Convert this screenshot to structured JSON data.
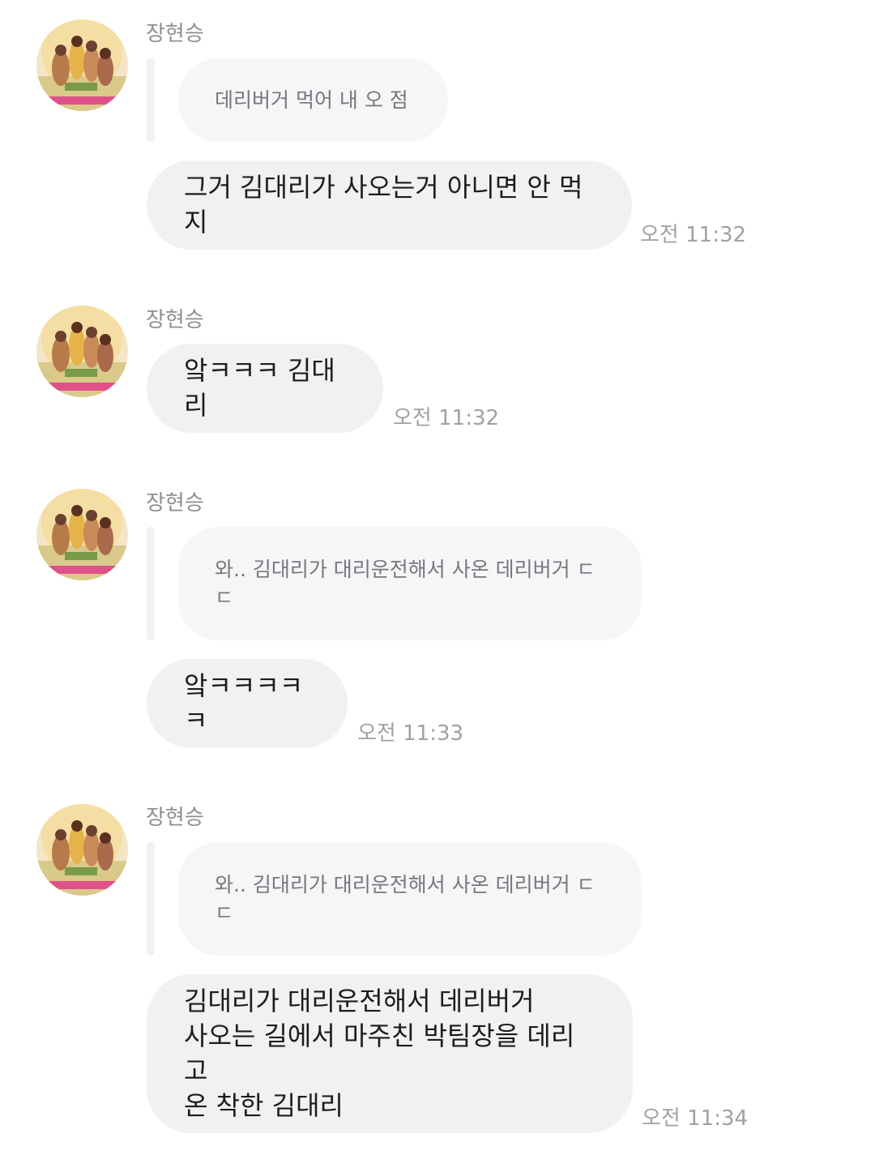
{
  "app": {
    "background": "#ffffff",
    "bubble_color": "#f1f1f4",
    "quote_color": "#f6f6f8"
  },
  "messages": [
    {
      "sender": "장현승",
      "quote": "데리버거 먹어 내 오 점",
      "text": "그거 김대리가 사오는거 아니면 안 먹지",
      "time": "오전 11:32"
    },
    {
      "sender": "장현승",
      "text": "앜ㅋㅋㅋ 김대리",
      "time": "오전 11:32"
    },
    {
      "sender": "장현승",
      "quote": "와.. 김대리가 대리운전해서 사온 데리버거 ㄷ\nㄷ",
      "text": "앜ㅋㅋㅋㅋㅋ",
      "time": "오전 11:33"
    },
    {
      "sender": "장현승",
      "quote": "와.. 김대리가 대리운전해서 사온 데리버거 ㄷ\nㄷ",
      "text": "김대리가 대리운전해서 데리버거\n사오는 길에서 마주친 박팀장을 데리고\n온 착한 김대리",
      "time": "오전 11:34"
    }
  ]
}
